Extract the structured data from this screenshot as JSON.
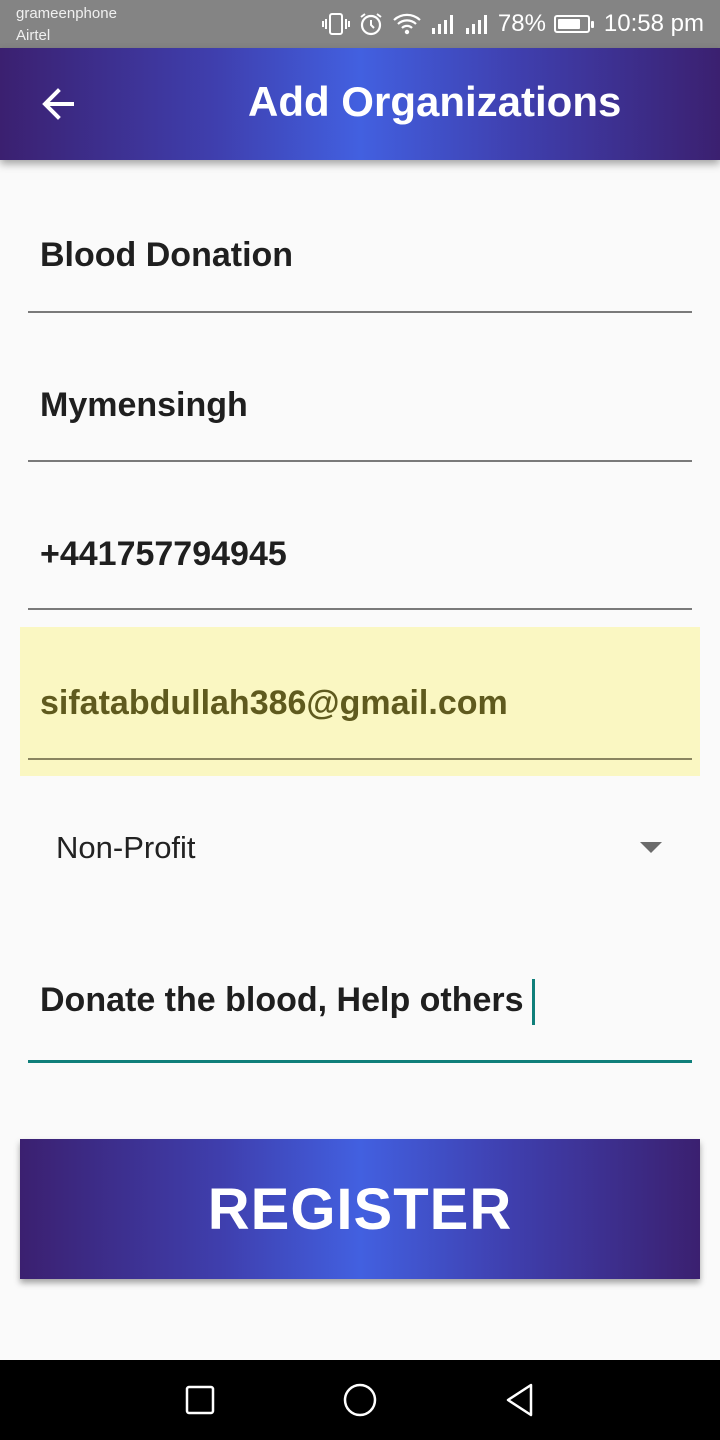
{
  "status_bar": {
    "carrier_primary": "grameenphone",
    "carrier_secondary": "Airtel",
    "battery_percent_text": "78%",
    "battery_level": 0.78,
    "time": "10:58 pm",
    "icons": [
      "vibrate-icon",
      "alarm-icon",
      "wifi-icon",
      "signal-icon",
      "signal-icon",
      "battery-icon"
    ]
  },
  "app_bar": {
    "title": "Add Organizations",
    "back_icon": "arrow-left-icon",
    "gradient_colors": [
      "#3b2070",
      "#4260e0",
      "#3b2070"
    ]
  },
  "form": {
    "name": "Blood Donation",
    "location": "Mymensingh",
    "phone": "+441757794945",
    "email": "sifatabdullah386@gmail.com",
    "type_selected": "Non-Profit",
    "description": "Donate the blood, Help others"
  },
  "register_button": {
    "label": "REGISTER"
  },
  "colors": {
    "accent_underline": "#0f7f7a",
    "autofill_highlight": "#faf7c2",
    "autofill_text": "#5f5a1e"
  },
  "nav_bar": {
    "icons": [
      "recent-apps-icon",
      "home-icon",
      "back-triangle-icon"
    ]
  }
}
